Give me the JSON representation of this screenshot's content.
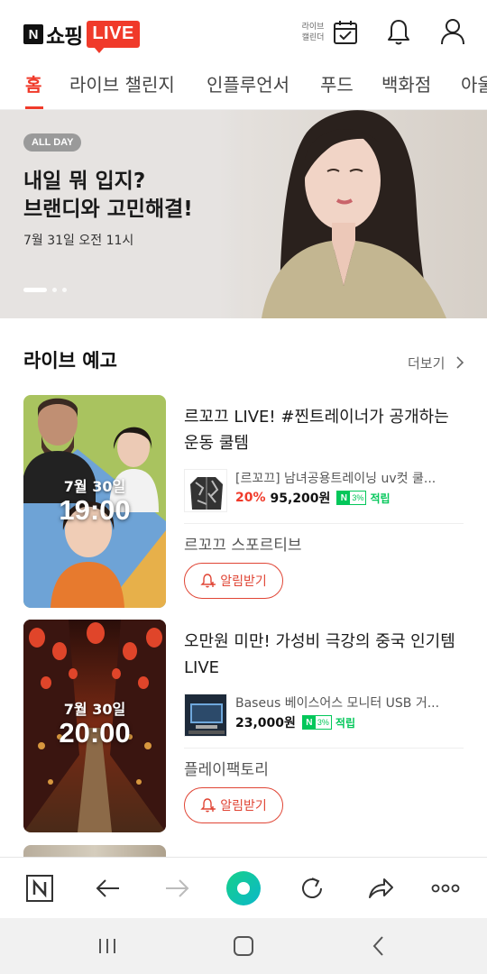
{
  "header": {
    "logo_n": "N",
    "logo_text": "쇼핑",
    "logo_live": "LIVE",
    "calendar_label_line1": "라이브",
    "calendar_label_line2": "캘린더"
  },
  "tabs": [
    {
      "label": "홈",
      "active": true
    },
    {
      "label": "라이브 챌린지",
      "active": false
    },
    {
      "label": "인플루언서",
      "active": false
    },
    {
      "label": "푸드",
      "active": false
    },
    {
      "label": "백화점",
      "active": false
    },
    {
      "label": "아울",
      "active": false
    }
  ],
  "banner": {
    "badge": "ALL DAY",
    "title_line1": "내일 뭐 입지?",
    "title_line2": "브랜디와 고민해결!",
    "date": "7월 31일 오전 11시",
    "slide_count": 3,
    "active_slide": 1
  },
  "section": {
    "title": "라이브 예고",
    "more_label": "더보기"
  },
  "cards": [
    {
      "thumb_date": "7월 30일",
      "thumb_time": "19:00",
      "title": "르꼬끄 LIVE! #찐트레이너가 공개하는 운동 쿨템",
      "product_name": "[르꼬끄] 남녀공용트레이닝 uv컷 쿨...",
      "discount": "20%",
      "price": "95,200원",
      "npay_n": "N",
      "npay_pct": "3%",
      "earn": "적립",
      "seller": "르꼬끄 스포르티브",
      "alarm_label": "알림받기"
    },
    {
      "thumb_date": "7월 30일",
      "thumb_time": "20:00",
      "title": "오만원 미만! 가성비 극강의 중국 인기템 LIVE",
      "product_name": "Baseus 베이스어스 모니터 USB 거...",
      "discount": "",
      "price": "23,000원",
      "npay_n": "N",
      "npay_pct": "3%",
      "earn": "적립",
      "seller": "플레이팩토리",
      "alarm_label": "알림받기"
    }
  ],
  "bottom_bar": {
    "home_icon": "naver-n-icon",
    "back_icon": "arrow-left-icon",
    "forward_icon": "arrow-right-icon",
    "center_icon": "green-circle-icon",
    "refresh_icon": "refresh-icon",
    "share_icon": "share-icon",
    "more_icon": "more-dots-icon"
  },
  "colors": {
    "accent": "#f03a2a",
    "green": "#03c75a"
  }
}
